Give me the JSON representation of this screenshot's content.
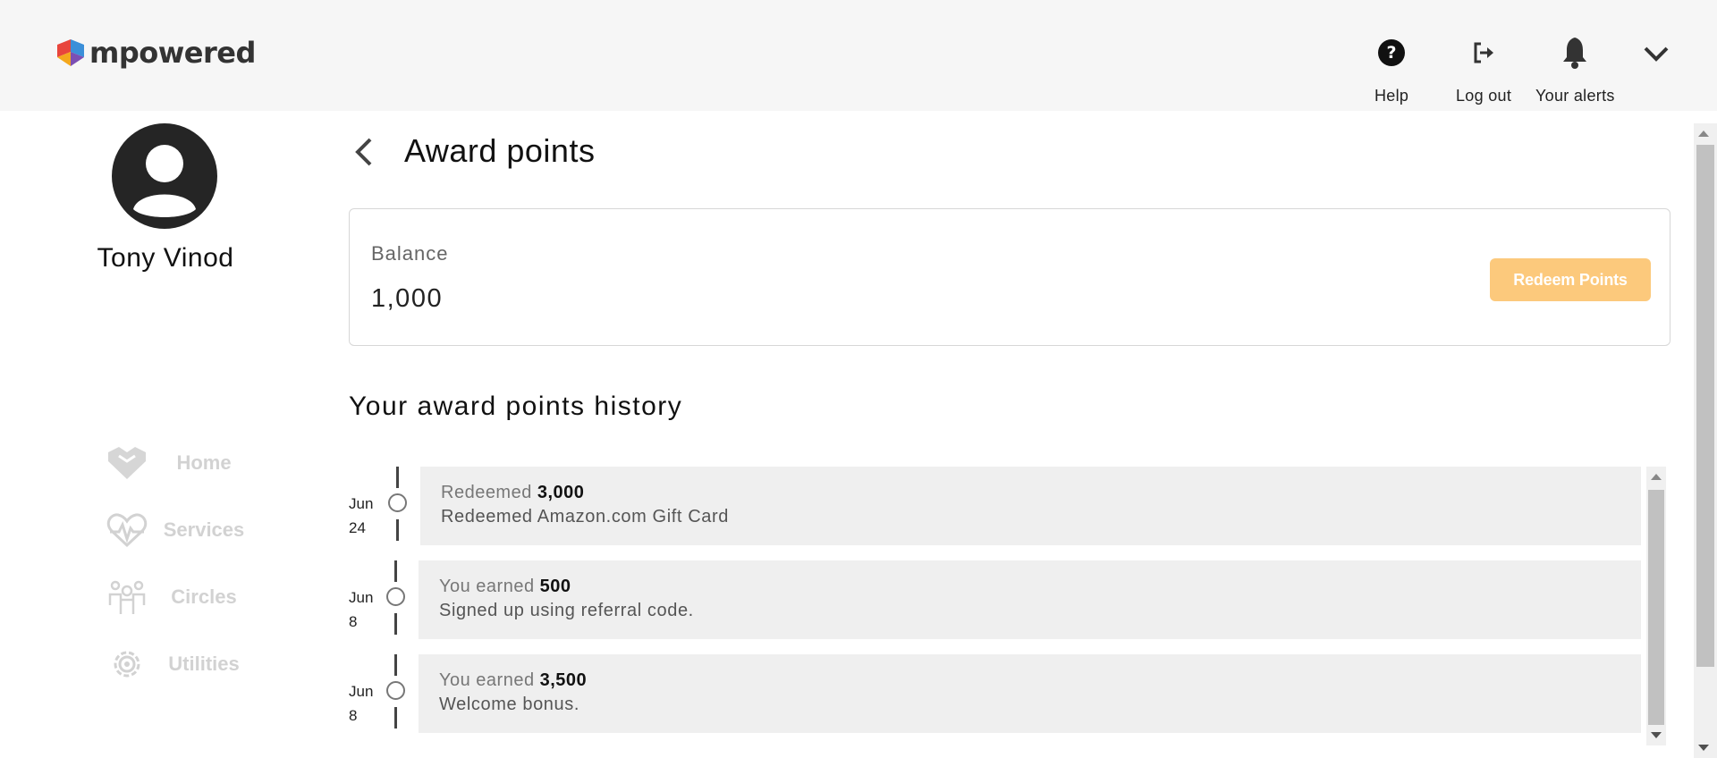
{
  "app": {
    "brand": "mpowered"
  },
  "topnav": {
    "help_label": "Help",
    "logout_label": "Log out",
    "alerts_label": "Your alerts"
  },
  "user": {
    "name": "Tony Vinod"
  },
  "sidebar": {
    "items": [
      {
        "label": "Home",
        "icon": "home-heart-icon"
      },
      {
        "label": "Services",
        "icon": "heart-pulse-icon"
      },
      {
        "label": "Circles",
        "icon": "people-icon"
      },
      {
        "label": "Utilities",
        "icon": "gear-icon"
      }
    ]
  },
  "page": {
    "title": "Award points"
  },
  "balance": {
    "label": "Balance",
    "value": "1,000",
    "redeem_label": "Redeem Points"
  },
  "history": {
    "title": "Your award points history",
    "entries": [
      {
        "month": "Jun",
        "day": "24",
        "action": "Redeemed",
        "amount": "3,000",
        "description": "Redeemed Amazon.com Gift Card"
      },
      {
        "month": "Jun",
        "day": "8",
        "action": "You earned",
        "amount": "500",
        "description": "Signed up using referral code."
      },
      {
        "month": "Jun",
        "day": "8",
        "action": "You earned",
        "amount": "3,500",
        "description": "Welcome bonus."
      }
    ]
  },
  "colors": {
    "topbar_bg": "#f6f6f6",
    "redeem_button_disabled": "#fcc97c",
    "history_card_bg": "#efefef",
    "nav_disabled_text": "#d2d2d2"
  }
}
